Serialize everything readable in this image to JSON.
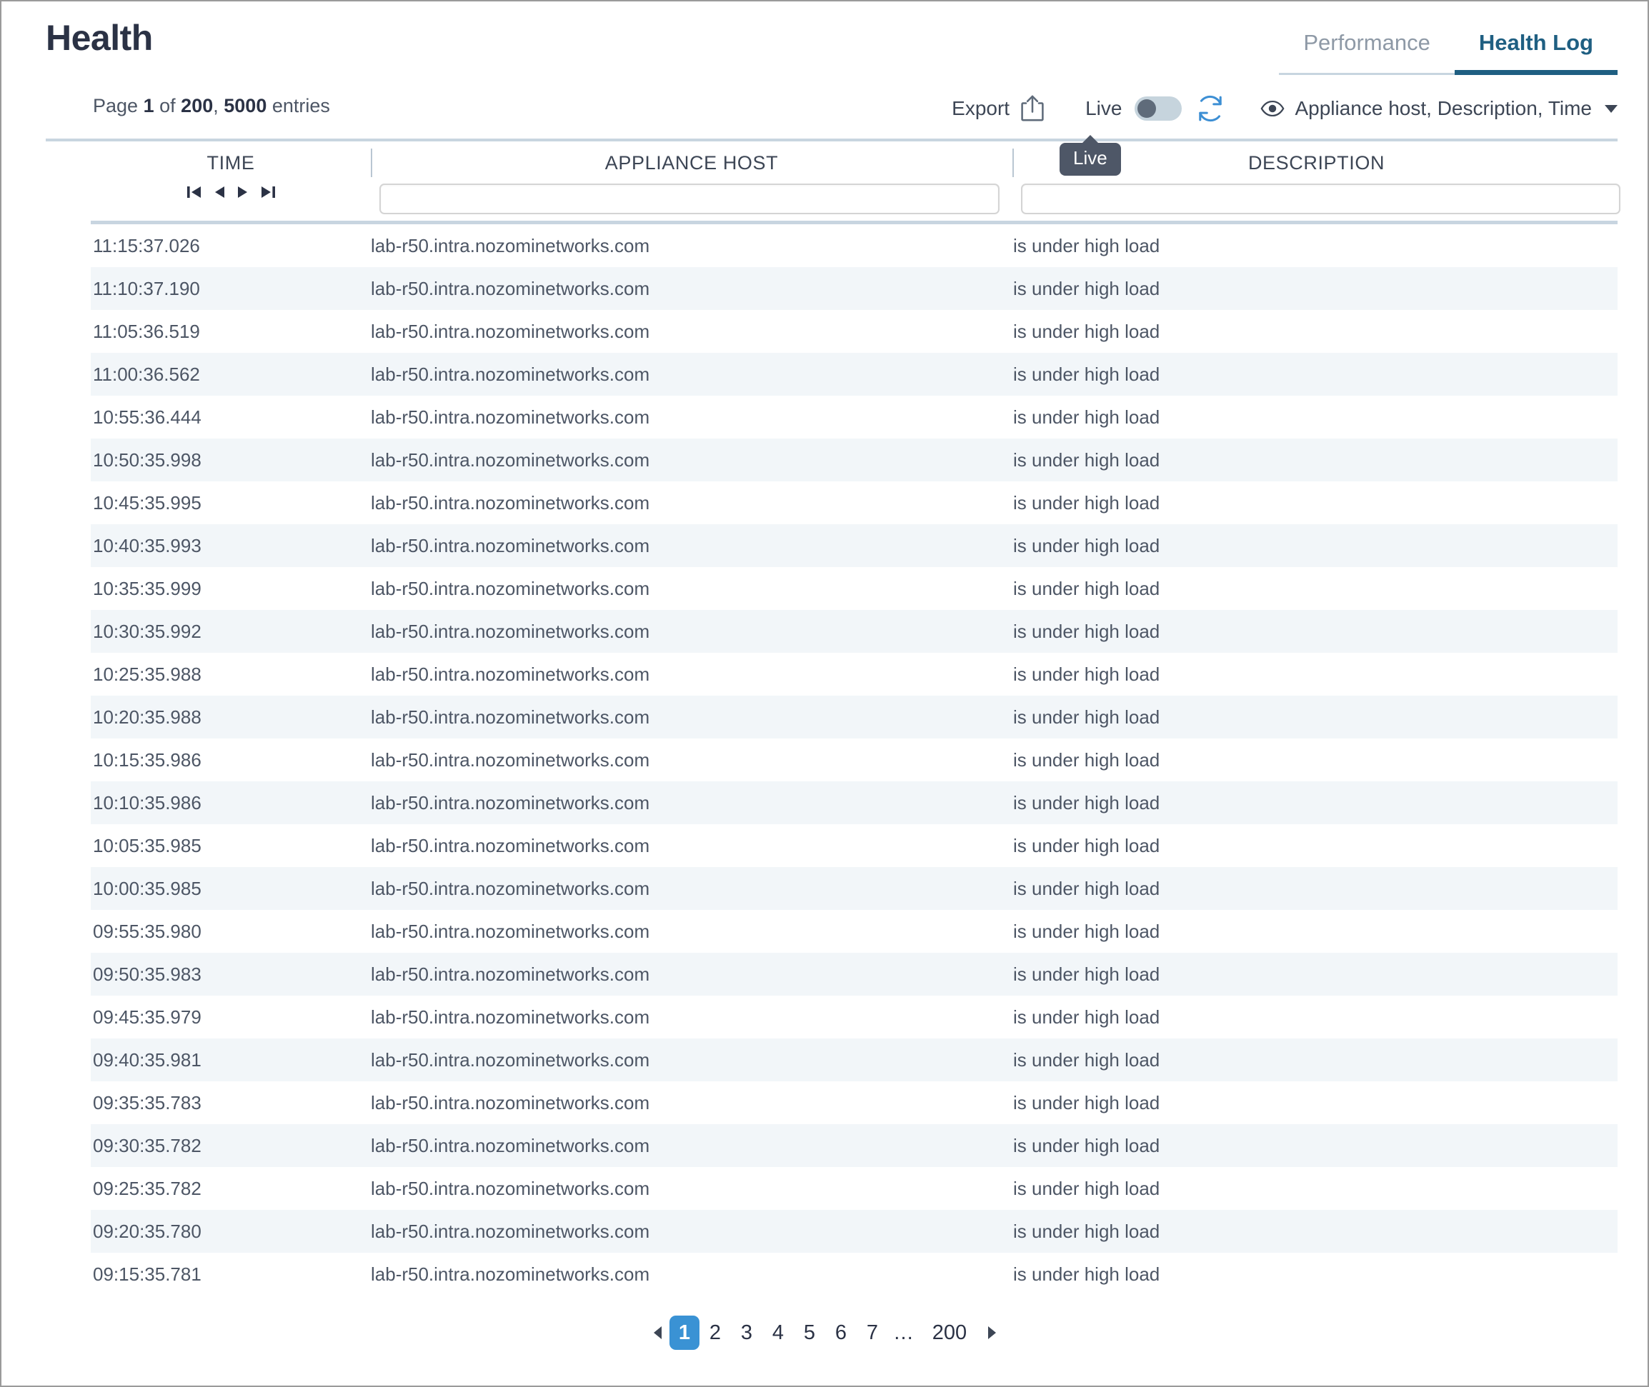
{
  "page_title": "Health",
  "tabs": [
    {
      "label": "Performance",
      "active": false
    },
    {
      "label": "Health Log",
      "active": true
    }
  ],
  "entries_info": {
    "prefix": "Page",
    "current_page": "1",
    "of": "of",
    "total_pages": "200",
    "separator": ",",
    "total_entries": "5000",
    "suffix": "entries"
  },
  "toolbar": {
    "export_label": "Export",
    "live_label": "Live",
    "live_toggle_on": false,
    "column_selector_label": "Appliance host, Description, Time"
  },
  "tooltip": {
    "text": "Live"
  },
  "columns": [
    {
      "key": "time",
      "label": "TIME",
      "has_nav": true,
      "has_filter": false
    },
    {
      "key": "host",
      "label": "APPLIANCE HOST",
      "has_nav": false,
      "has_filter": true,
      "filter_value": "",
      "filter_placeholder": ""
    },
    {
      "key": "description",
      "label": "DESCRIPTION",
      "has_nav": false,
      "has_filter": true,
      "filter_value": "",
      "filter_placeholder": ""
    }
  ],
  "time_nav": [
    {
      "name": "first",
      "title": "First"
    },
    {
      "name": "previous",
      "title": "Previous"
    },
    {
      "name": "next",
      "title": "Next"
    },
    {
      "name": "last",
      "title": "Last"
    }
  ],
  "rows": [
    {
      "time": "11:15:37.026",
      "host": "lab-r50.intra.nozominetworks.com",
      "description": "is under high load"
    },
    {
      "time": "11:10:37.190",
      "host": "lab-r50.intra.nozominetworks.com",
      "description": "is under high load"
    },
    {
      "time": "11:05:36.519",
      "host": "lab-r50.intra.nozominetworks.com",
      "description": "is under high load"
    },
    {
      "time": "11:00:36.562",
      "host": "lab-r50.intra.nozominetworks.com",
      "description": "is under high load"
    },
    {
      "time": "10:55:36.444",
      "host": "lab-r50.intra.nozominetworks.com",
      "description": "is under high load"
    },
    {
      "time": "10:50:35.998",
      "host": "lab-r50.intra.nozominetworks.com",
      "description": "is under high load"
    },
    {
      "time": "10:45:35.995",
      "host": "lab-r50.intra.nozominetworks.com",
      "description": "is under high load"
    },
    {
      "time": "10:40:35.993",
      "host": "lab-r50.intra.nozominetworks.com",
      "description": "is under high load"
    },
    {
      "time": "10:35:35.999",
      "host": "lab-r50.intra.nozominetworks.com",
      "description": "is under high load"
    },
    {
      "time": "10:30:35.992",
      "host": "lab-r50.intra.nozominetworks.com",
      "description": "is under high load"
    },
    {
      "time": "10:25:35.988",
      "host": "lab-r50.intra.nozominetworks.com",
      "description": "is under high load"
    },
    {
      "time": "10:20:35.988",
      "host": "lab-r50.intra.nozominetworks.com",
      "description": "is under high load"
    },
    {
      "time": "10:15:35.986",
      "host": "lab-r50.intra.nozominetworks.com",
      "description": "is under high load"
    },
    {
      "time": "10:10:35.986",
      "host": "lab-r50.intra.nozominetworks.com",
      "description": "is under high load"
    },
    {
      "time": "10:05:35.985",
      "host": "lab-r50.intra.nozominetworks.com",
      "description": "is under high load"
    },
    {
      "time": "10:00:35.985",
      "host": "lab-r50.intra.nozominetworks.com",
      "description": "is under high load"
    },
    {
      "time": "09:55:35.980",
      "host": "lab-r50.intra.nozominetworks.com",
      "description": "is under high load"
    },
    {
      "time": "09:50:35.983",
      "host": "lab-r50.intra.nozominetworks.com",
      "description": "is under high load"
    },
    {
      "time": "09:45:35.979",
      "host": "lab-r50.intra.nozominetworks.com",
      "description": "is under high load"
    },
    {
      "time": "09:40:35.981",
      "host": "lab-r50.intra.nozominetworks.com",
      "description": "is under high load"
    },
    {
      "time": "09:35:35.783",
      "host": "lab-r50.intra.nozominetworks.com",
      "description": "is under high load"
    },
    {
      "time": "09:30:35.782",
      "host": "lab-r50.intra.nozominetworks.com",
      "description": "is under high load"
    },
    {
      "time": "09:25:35.782",
      "host": "lab-r50.intra.nozominetworks.com",
      "description": "is under high load"
    },
    {
      "time": "09:20:35.780",
      "host": "lab-r50.intra.nozominetworks.com",
      "description": "is under high load"
    },
    {
      "time": "09:15:35.781",
      "host": "lab-r50.intra.nozominetworks.com",
      "description": "is under high load"
    }
  ],
  "pagination": {
    "prev_arrow": "prev",
    "next_arrow": "next",
    "pages": [
      "1",
      "2",
      "3",
      "4",
      "5",
      "6",
      "7",
      "…",
      "200"
    ],
    "active_page": "1"
  },
  "colors": {
    "accent_blue": "#1f5f82",
    "active_page_blue": "#3a92d4",
    "refresh_blue": "#3d8fd4",
    "rule": "#c8d5e0",
    "row_alt": "#f2f6f9",
    "text": "#4d5665",
    "title": "#2b3245",
    "tooltip_bg": "#4e5767",
    "toggle_track": "#c6d4dd",
    "toggle_knob": "#5f6b7a"
  }
}
